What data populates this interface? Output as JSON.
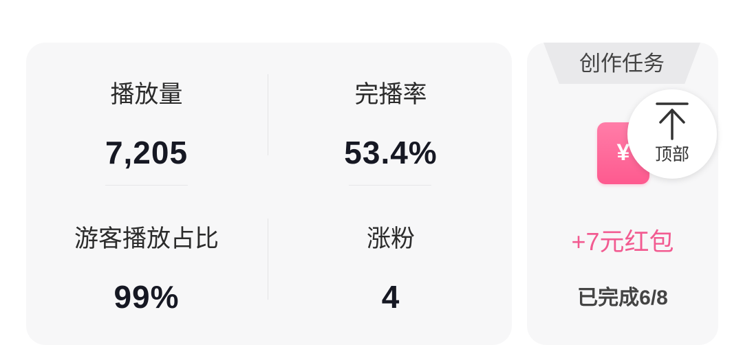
{
  "stats": {
    "plays_label": "播放量",
    "plays_value": "7,205",
    "completion_label": "完播率",
    "completion_value": "53.4%",
    "guest_ratio_label": "游客播放占比",
    "guest_ratio_value": "99%",
    "followers_label": "涨粉",
    "followers_value": "4"
  },
  "task": {
    "tab_label": "创作任务",
    "icon": "red-packet-icon",
    "glyph": "¥",
    "reward": "+7元红包",
    "progress": "已完成6/8",
    "accent_color": "#f25b91"
  },
  "top_button": {
    "label": "顶部",
    "icon": "arrow-to-top-icon"
  }
}
